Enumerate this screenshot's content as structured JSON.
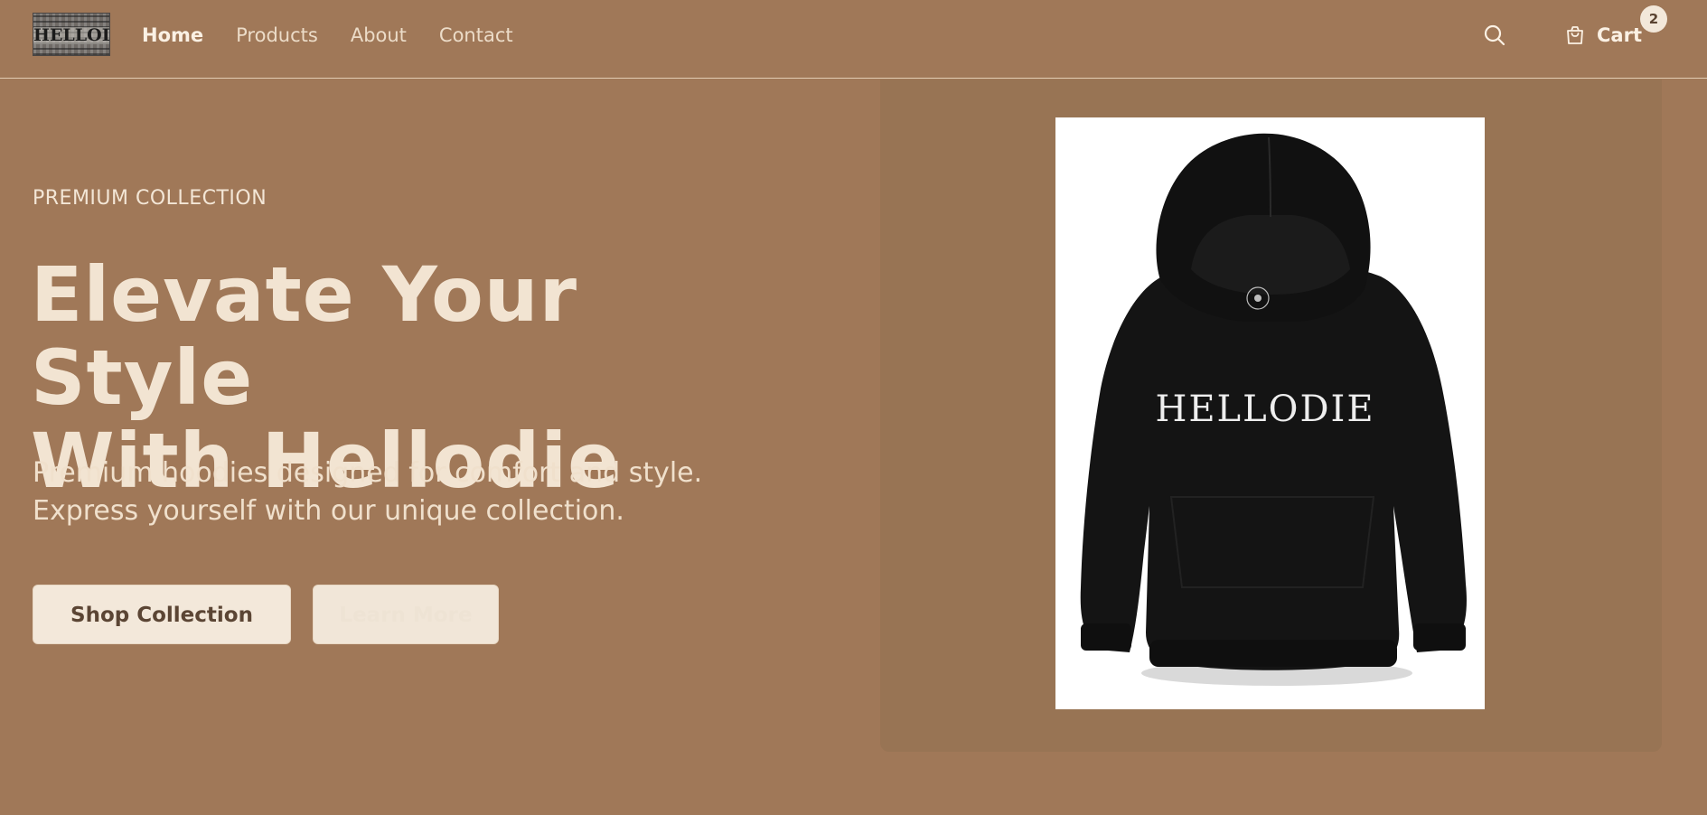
{
  "header": {
    "logo_text": "HELLODIE",
    "nav": [
      {
        "label": "Home",
        "active": true
      },
      {
        "label": "Products",
        "active": false
      },
      {
        "label": "About",
        "active": false
      },
      {
        "label": "Contact",
        "active": false
      }
    ],
    "search_icon": "search-icon",
    "cart": {
      "label": "Cart",
      "count": "2",
      "icon": "shopping-bag-icon"
    }
  },
  "hero": {
    "eyebrow": "PREMIUM COLLECTION",
    "headline_line1": "Elevate Your Style",
    "headline_line2": "With Hellodie",
    "subtitle_line1": "Premium hoodies designed for comfort and style.",
    "subtitle_line2": "Express yourself with our unique collection.",
    "primary_button": "Shop Collection",
    "secondary_button": "Learn More",
    "product_print": "HELLODIE"
  },
  "colors": {
    "background": "#a07858",
    "panel": "#987454",
    "cream": "#f3e8da",
    "text_brown": "#5b4534",
    "hoodie": "#141414"
  }
}
